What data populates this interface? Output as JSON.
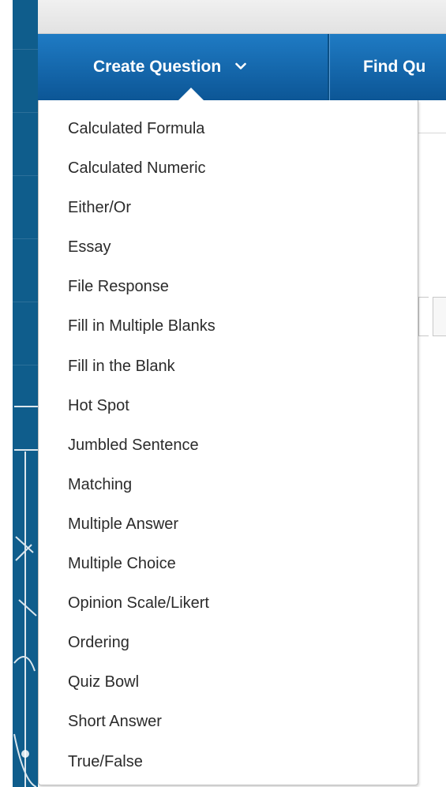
{
  "tabs": {
    "create_question": "Create Question",
    "find_questions": "Find Qu"
  },
  "icons": {
    "create_chevron": "chevron-down-icon"
  },
  "colors": {
    "tab_top": "#1f7bc4",
    "tab_bottom": "#0c5696",
    "left_bar": "#0f5d8c",
    "menu_text": "#2b2b2b"
  },
  "menu": {
    "items": [
      {
        "label": "Calculated Formula"
      },
      {
        "label": "Calculated Numeric"
      },
      {
        "label": "Either/Or"
      },
      {
        "label": "Essay"
      },
      {
        "label": "File Response"
      },
      {
        "label": "Fill in Multiple Blanks"
      },
      {
        "label": "Fill in the Blank"
      },
      {
        "label": "Hot Spot"
      },
      {
        "label": "Jumbled Sentence"
      },
      {
        "label": "Matching"
      },
      {
        "label": "Multiple Answer"
      },
      {
        "label": "Multiple Choice"
      },
      {
        "label": "Opinion Scale/Likert"
      },
      {
        "label": "Ordering"
      },
      {
        "label": "Quiz Bowl"
      },
      {
        "label": "Short Answer"
      },
      {
        "label": "True/False"
      }
    ]
  }
}
